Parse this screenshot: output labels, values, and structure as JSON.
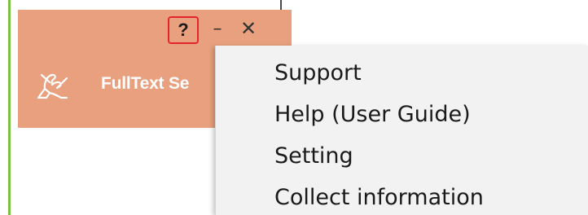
{
  "header": {
    "app_title": "FullText Se",
    "help_label": "?",
    "minimize_label": "–",
    "close_label": "✕",
    "logo_icon": "pen-hand-icon",
    "background_color": "#e8a07e",
    "help_highlight_color": "#e4252a"
  },
  "menu": {
    "items": [
      {
        "label": "Support"
      },
      {
        "label": "Help (User Guide)"
      },
      {
        "label": "Setting"
      },
      {
        "label": "Collect information"
      }
    ],
    "background_color": "#f2f2f2"
  }
}
